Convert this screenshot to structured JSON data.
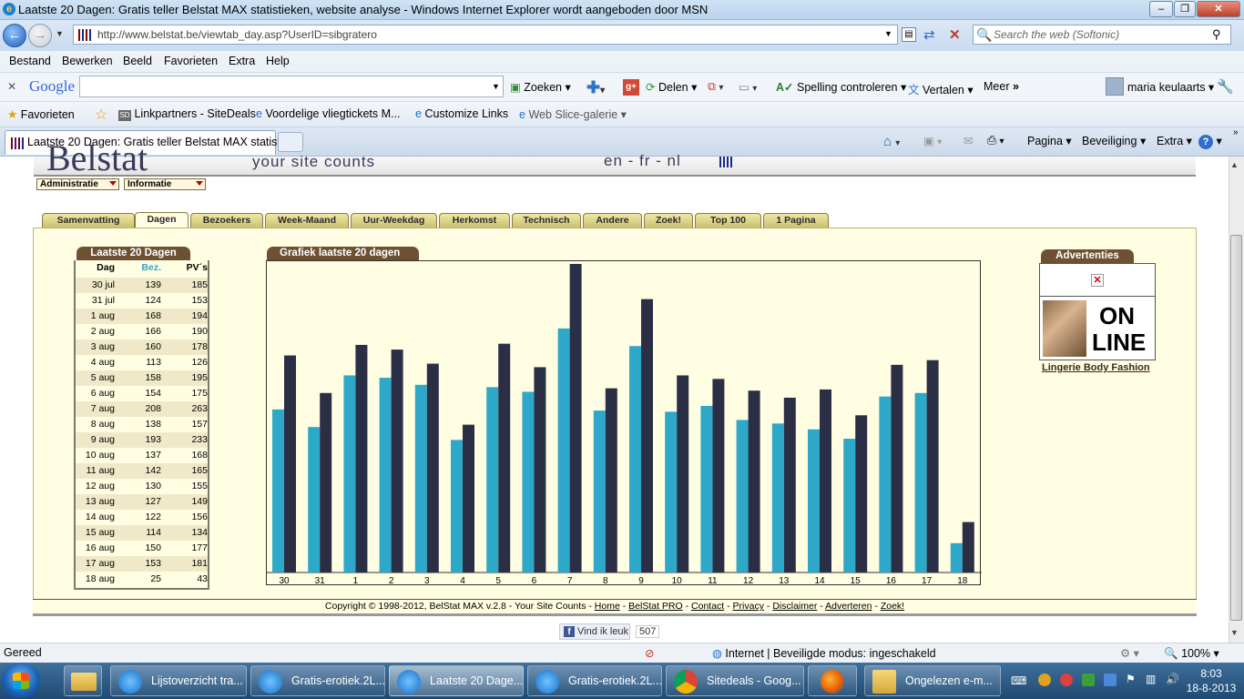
{
  "window": {
    "title": "Laatste 20 Dagen: Gratis teller Belstat MAX statistieken, website analyse - Windows Internet Explorer wordt aangeboden door MSN"
  },
  "address": {
    "url": "http://www.belstat.be/viewtab_day.asp?UserID=sibgratero",
    "search_placeholder": "Search the web (Softonic)"
  },
  "menu": [
    "Bestand",
    "Bewerken",
    "Beeld",
    "Favorieten",
    "Extra",
    "Help"
  ],
  "google_toolbar": {
    "logo": "Google",
    "search": "Zoeken",
    "share": "Delen",
    "spelling": "Spelling controleren",
    "translate": "Vertalen",
    "more": "Meer",
    "user": "maria keulaarts"
  },
  "favorites_bar": {
    "favorites": "Favorieten",
    "items": [
      "Linkpartners - SiteDeals",
      "Voordelige vliegtickets M...",
      "Customize Links",
      "Web Slice-galerie"
    ]
  },
  "tab": {
    "title": "Laatste 20 Dagen: Gratis teller Belstat MAX statisti..."
  },
  "command_bar": {
    "page": "Pagina",
    "security": "Beveiliging",
    "extra": "Extra"
  },
  "page": {
    "logo_partial": "Belstat",
    "tagline": "your site counts",
    "languages": "en - fr - nl",
    "dropdowns": [
      "Administratie",
      "Informatie"
    ],
    "tabs": [
      "Samenvatting",
      "Dagen",
      "Bezoekers",
      "Week-Maand",
      "Uur-Weekdag",
      "Herkomst",
      "Technisch",
      "Andere",
      "Zoek!",
      "Top 100",
      "1 Pagina"
    ],
    "active_tab": "Dagen",
    "table": {
      "title": "Laatste 20 Dagen",
      "headers": [
        "Dag",
        "Bez.",
        "PV´s"
      ],
      "rows": [
        [
          "30 jul",
          "139",
          "185"
        ],
        [
          "31 jul",
          "124",
          "153"
        ],
        [
          "1 aug",
          "168",
          "194"
        ],
        [
          "2 aug",
          "166",
          "190"
        ],
        [
          "3 aug",
          "160",
          "178"
        ],
        [
          "4 aug",
          "113",
          "126"
        ],
        [
          "5 aug",
          "158",
          "195"
        ],
        [
          "6 aug",
          "154",
          "175"
        ],
        [
          "7 aug",
          "208",
          "263"
        ],
        [
          "8 aug",
          "138",
          "157"
        ],
        [
          "9 aug",
          "193",
          "233"
        ],
        [
          "10 aug",
          "137",
          "168"
        ],
        [
          "11 aug",
          "142",
          "165"
        ],
        [
          "12 aug",
          "130",
          "155"
        ],
        [
          "13 aug",
          "127",
          "149"
        ],
        [
          "14 aug",
          "122",
          "156"
        ],
        [
          "15 aug",
          "114",
          "134"
        ],
        [
          "16 aug",
          "150",
          "177"
        ],
        [
          "17 aug",
          "153",
          "181"
        ],
        [
          "18 aug",
          "25",
          "43"
        ]
      ]
    },
    "chart_title": "Grafiek laatste 20 dagen",
    "ads": {
      "title": "Advertenties",
      "banner_line1": "ON",
      "banner_line2": "LINE",
      "link": "Lingerie Body Fashion"
    },
    "footer": {
      "copyright": "Copyright © 1998-2012, BelStat MAX v.2.8 - Your Site Counts -",
      "links": [
        "Home",
        "BelStat PRO",
        "Contact",
        "Privacy",
        "Disclaimer",
        "Adverteren",
        "Zoek!"
      ]
    },
    "like": {
      "label": "Vind ik leuk",
      "count": "507"
    }
  },
  "chart_data": {
    "type": "bar",
    "title": "Grafiek laatste 20 dagen",
    "categories": [
      "30",
      "31",
      "1",
      "2",
      "3",
      "4",
      "5",
      "6",
      "7",
      "8",
      "9",
      "10",
      "11",
      "12",
      "13",
      "14",
      "15",
      "16",
      "17",
      "18"
    ],
    "series": [
      {
        "name": "Bez.",
        "values": [
          139,
          124,
          168,
          166,
          160,
          113,
          158,
          154,
          208,
          138,
          193,
          137,
          142,
          130,
          127,
          122,
          114,
          150,
          153,
          25
        ]
      },
      {
        "name": "PV´s",
        "values": [
          185,
          153,
          194,
          190,
          178,
          126,
          195,
          175,
          263,
          157,
          233,
          168,
          165,
          155,
          149,
          156,
          134,
          177,
          181,
          43
        ]
      }
    ],
    "colors": [
      "#2ea8c8",
      "#2b2f45"
    ],
    "ylim": [
      0,
      263
    ],
    "grid": false
  },
  "status": {
    "text": "Gereed",
    "zone": "Internet | Beveiligde modus: ingeschakeld",
    "zoom": "100%"
  },
  "taskbar": {
    "items": [
      "Lijstoverzicht tra...",
      "Gratis-erotiek.2L...",
      "Laatste 20 Dage...",
      "Gratis-erotiek.2L...",
      "Sitedeals - Goog...",
      "",
      "Ongelezen e-m..."
    ],
    "active_index": 2,
    "time": "8:03",
    "date": "18-8-2013"
  }
}
